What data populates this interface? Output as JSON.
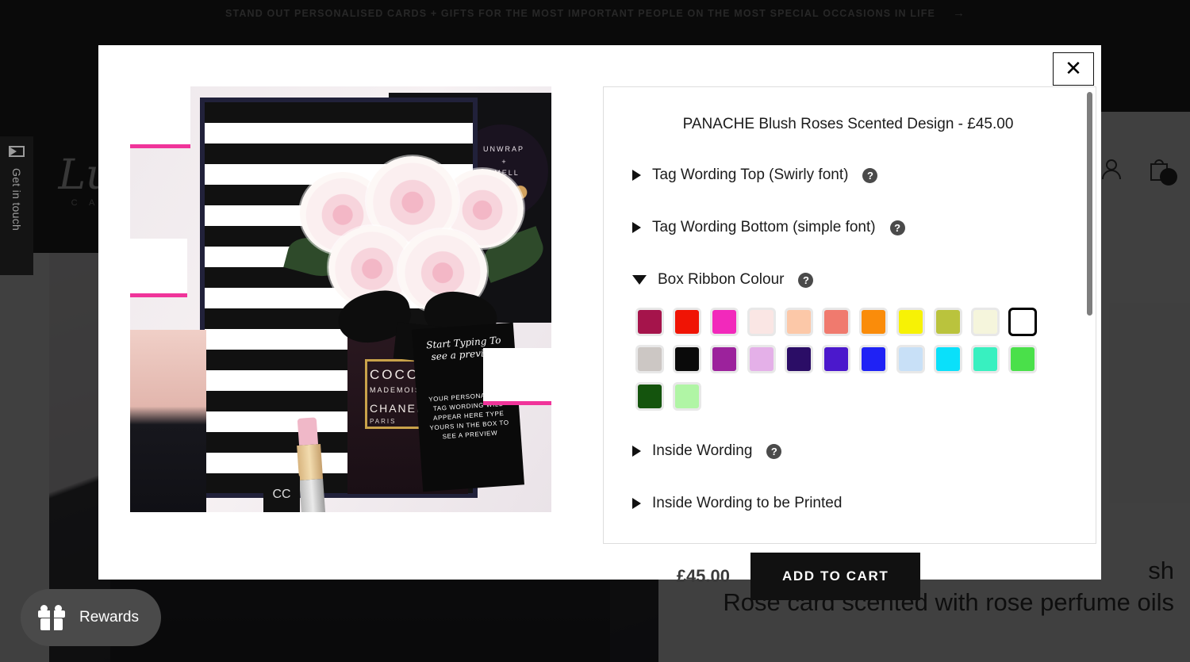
{
  "announcement": {
    "text": "STAND OUT PERSONALISED CARDS + GIFTS FOR THE MOST IMPORTANT PEOPLE ON THE MOST SPECIAL OCCASIONS IN LIFE",
    "arrow": "→"
  },
  "header": {
    "logo_mark": "Lu",
    "logo_sub": "C A",
    "cart_icon": "shopping-bag-icon"
  },
  "side_tab": {
    "label": "Get in touch",
    "icon": "envelope-icon"
  },
  "rewards_widget": {
    "label": "Rewards",
    "icon": "gift-icon"
  },
  "background_product": {
    "line1_partial": "sh",
    "line2": "Rose card scented with rose perfume oils"
  },
  "modal": {
    "close_label": "✕",
    "title": "PANACHE Blush Roses Scented Design - £45.00",
    "price": "£45.00",
    "add_to_cart": "ADD TO CART",
    "help_glyph": "?",
    "options": [
      {
        "label": "Tag Wording Top (Swirly font)",
        "expanded": false
      },
      {
        "label": "Tag Wording Bottom (simple font)",
        "expanded": false
      },
      {
        "label": "Box Ribbon Colour",
        "expanded": true
      },
      {
        "label": "Inside Wording",
        "expanded": false
      },
      {
        "label": "Inside Wording to be Printed",
        "expanded": false
      }
    ],
    "ribbon_colours": [
      {
        "name": "burgundy",
        "hex": "#a5144b",
        "selected": false
      },
      {
        "name": "red",
        "hex": "#f01405",
        "selected": false
      },
      {
        "name": "magenta",
        "hex": "#f229bb",
        "selected": false
      },
      {
        "name": "pale-pink",
        "hex": "#fae6e4",
        "selected": false
      },
      {
        "name": "peach",
        "hex": "#fcc8a8",
        "selected": false
      },
      {
        "name": "salmon",
        "hex": "#f07a6e",
        "selected": false
      },
      {
        "name": "orange",
        "hex": "#fa8c0a",
        "selected": false
      },
      {
        "name": "yellow",
        "hex": "#f7f205",
        "selected": false
      },
      {
        "name": "olive",
        "hex": "#bac33d",
        "selected": false
      },
      {
        "name": "ivory",
        "hex": "#f5f5dc",
        "selected": false
      },
      {
        "name": "white",
        "hex": "#ffffff",
        "selected": true
      },
      {
        "name": "silver",
        "hex": "#ccc7c4",
        "selected": false
      },
      {
        "name": "black",
        "hex": "#0a0a0a",
        "selected": false
      },
      {
        "name": "purple",
        "hex": "#9c229c",
        "selected": false
      },
      {
        "name": "orchid",
        "hex": "#e4b0e8",
        "selected": false
      },
      {
        "name": "navy",
        "hex": "#2b0d66",
        "selected": false
      },
      {
        "name": "violet",
        "hex": "#4b18cc",
        "selected": false
      },
      {
        "name": "blue",
        "hex": "#1f22f5",
        "selected": false
      },
      {
        "name": "baby-blue",
        "hex": "#c8e0f7",
        "selected": false
      },
      {
        "name": "cyan",
        "hex": "#0ae0fa",
        "selected": false
      },
      {
        "name": "turquoise",
        "hex": "#38f0c0",
        "selected": false
      },
      {
        "name": "green",
        "hex": "#4ae04a",
        "selected": false
      },
      {
        "name": "dark-green",
        "hex": "#14540d",
        "selected": false
      },
      {
        "name": "mint",
        "hex": "#b0f5a5",
        "selected": false
      }
    ]
  },
  "preview_image": {
    "sticker_line1": "UNWRAP",
    "sticker_line2": "+",
    "sticker_line3": "SMELL",
    "bottle_line1": "COCO",
    "bottle_line2": "MADEMOISELLE",
    "bottle_line3": "CHANEL",
    "bottle_line4": "PARIS",
    "tag_script": "Start Typing\nTo see a preview",
    "tag_lines": "YOUR PERSONALISED\nTAG WORDING\nWILL APPEAR HERE\nTYPE YOURS IN THE BOX\nTO SEE A PREVIEW",
    "cap_mark": "CC"
  }
}
